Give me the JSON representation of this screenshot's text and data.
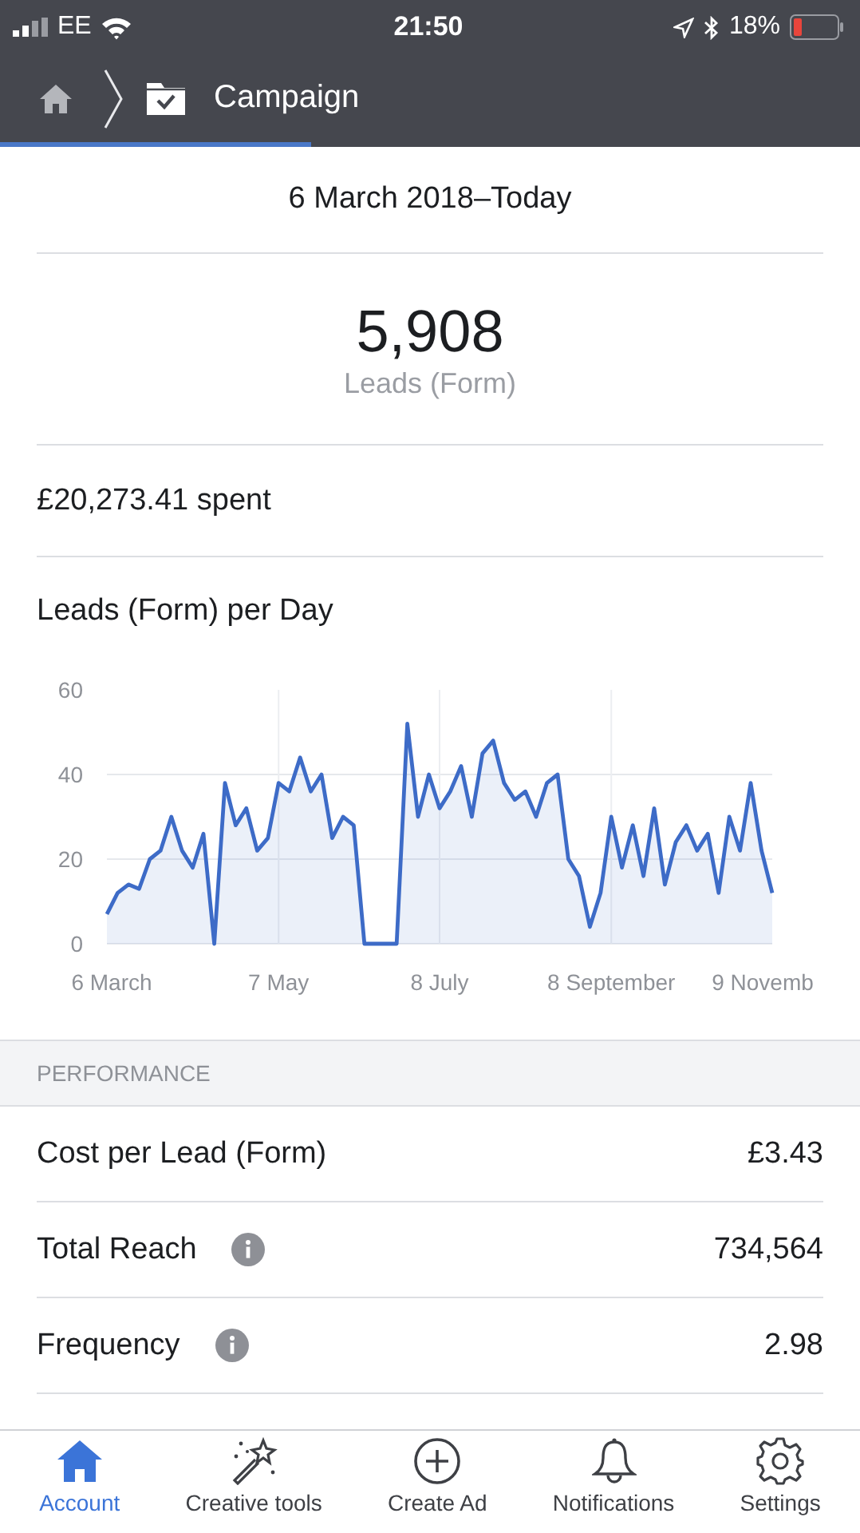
{
  "status_bar": {
    "carrier": "EE",
    "time": "21:50",
    "battery": "18%"
  },
  "nav": {
    "title": "Campaign"
  },
  "date_range": "6 March 2018–Today",
  "result": {
    "value": "5,908",
    "label": "Leads (Form)"
  },
  "spent": "£20,273.41 spent",
  "chart": {
    "title": "Leads (Form) per Day",
    "chart_data": {
      "type": "area",
      "categories": [
        "6 March",
        null,
        null,
        null,
        null,
        null,
        null,
        null,
        null,
        null,
        null,
        null,
        null,
        null,
        null,
        null,
        "7 May",
        null,
        null,
        null,
        null,
        null,
        null,
        null,
        null,
        null,
        null,
        null,
        null,
        null,
        null,
        "8 July",
        null,
        null,
        null,
        null,
        null,
        null,
        null,
        null,
        null,
        null,
        null,
        null,
        null,
        null,
        null,
        "8 September",
        null,
        null,
        null,
        null,
        null,
        null,
        null,
        null,
        null,
        null,
        null,
        null,
        null,
        null,
        "9 Novemb"
      ],
      "series": [
        {
          "color": "#3d6bc7",
          "values": [
            7,
            12,
            14,
            13,
            20,
            22,
            30,
            22,
            18,
            26,
            0,
            38,
            28,
            32,
            22,
            25,
            38,
            36,
            44,
            36,
            40,
            25,
            30,
            28,
            0,
            0,
            0,
            0,
            52,
            30,
            40,
            32,
            36,
            42,
            30,
            45,
            48,
            38,
            34,
            36,
            30,
            38,
            40,
            20,
            16,
            4,
            12,
            30,
            18,
            28,
            16,
            32,
            14,
            24,
            28,
            22,
            26,
            12,
            30,
            22,
            38,
            22,
            12
          ]
        }
      ],
      "ylim": [
        0,
        60
      ],
      "yticks": [
        0,
        20,
        40,
        60
      ],
      "grid": true
    }
  },
  "performance": {
    "heading": "PERFORMANCE",
    "rows": [
      {
        "label": "Cost per Lead (Form)",
        "value": "£3.43",
        "info": false
      },
      {
        "label": "Total Reach",
        "value": "734,564",
        "info": true
      },
      {
        "label": "Frequency",
        "value": "2.98",
        "info": true
      }
    ]
  },
  "tabs": [
    {
      "label": "Account",
      "kind": "home",
      "selected": true
    },
    {
      "label": "Creative tools",
      "kind": "wand",
      "selected": false
    },
    {
      "label": "Create Ad",
      "kind": "plus",
      "selected": false
    },
    {
      "label": "Notifications",
      "kind": "bell",
      "selected": false
    },
    {
      "label": "Settings",
      "kind": "gear",
      "selected": false
    }
  ]
}
